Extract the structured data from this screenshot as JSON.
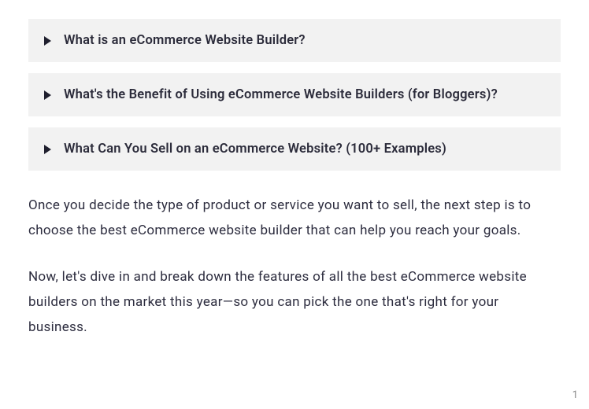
{
  "accordion": {
    "items": [
      {
        "title": "What is an eCommerce Website Builder?"
      },
      {
        "title": "What's the Benefit of Using eCommerce Website Builders (for Bloggers)?"
      },
      {
        "title": "What Can You Sell on an eCommerce Website? (100+ Examples)"
      }
    ]
  },
  "body": {
    "p1": "Once you decide the type of product or service you want to sell, the next step is to choose the best eCommerce website builder that can help you reach your goals.",
    "p2": "Now, let's dive in and break down the features of all the best eCommerce website builders on the market this year—so you can pick the one that's right for your business."
  },
  "page_number": "1"
}
